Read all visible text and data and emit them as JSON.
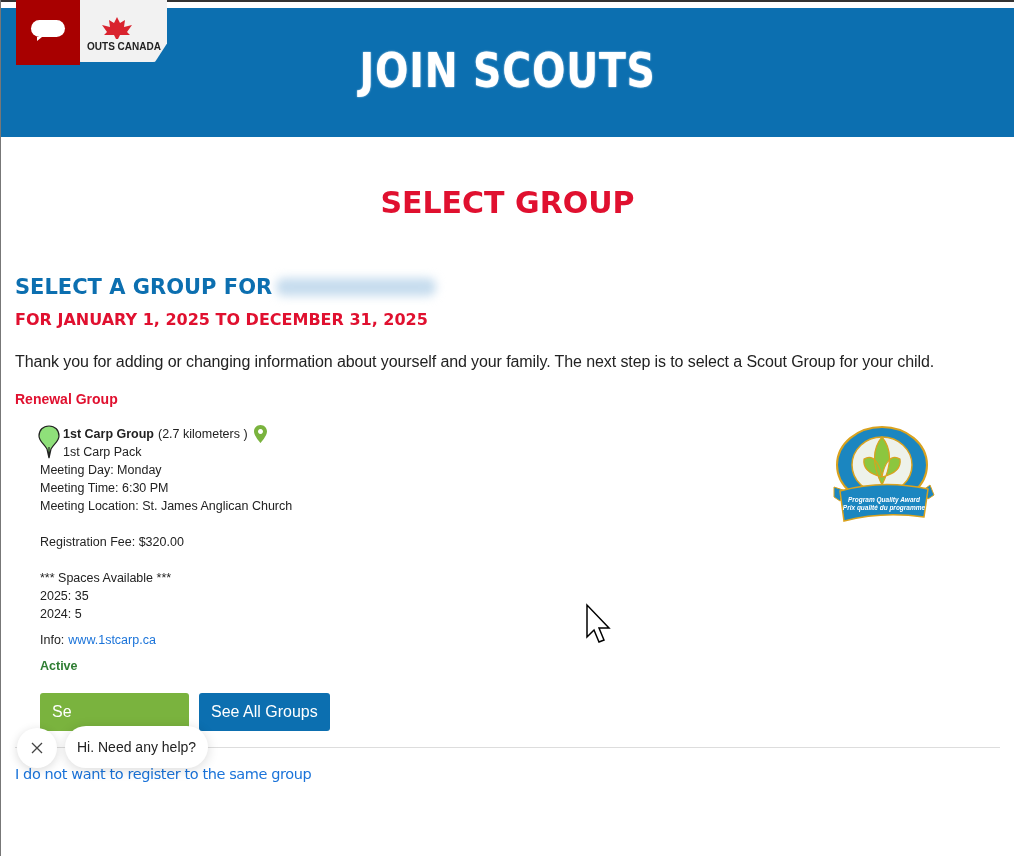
{
  "header": {
    "logo_text": "OUTS CANADA",
    "title": "JOIN SCOUTS"
  },
  "page_title": "SELECT GROUP",
  "heading": "SELECT A GROUP FOR",
  "period": "FOR JANUARY 1, 2025 TO DECEMBER 31, 2025",
  "intro": "Thank you for adding or changing information about yourself and your family. The next step is to select a Scout Group for your child.",
  "section_label": "Renewal Group",
  "group": {
    "name": "1st Carp Group",
    "distance": "(2.7 kilometers )",
    "section": "1st Carp Pack",
    "details": [
      "Meeting Day: Monday",
      "Meeting Time: 6:30 PM",
      "Meeting Location: St. James Anglican Church"
    ],
    "fee": "Registration Fee: $320.00",
    "spaces_title": "*** Spaces Available ***",
    "spaces": [
      "2025: 35",
      "2024: 5"
    ],
    "info_label": "Info:",
    "info_link": "www.1stcarp.ca",
    "status": "Active"
  },
  "badge": {
    "lines": [
      "Program Quality Award",
      "Prix qualité du programme"
    ]
  },
  "buttons": [
    {
      "label": "Se",
      "kind": "select"
    },
    {
      "label": "See All Groups",
      "kind": "all"
    }
  ],
  "chat": {
    "message": "Hi. Need any help?"
  },
  "footer_link": "I do not want to register to the same group"
}
